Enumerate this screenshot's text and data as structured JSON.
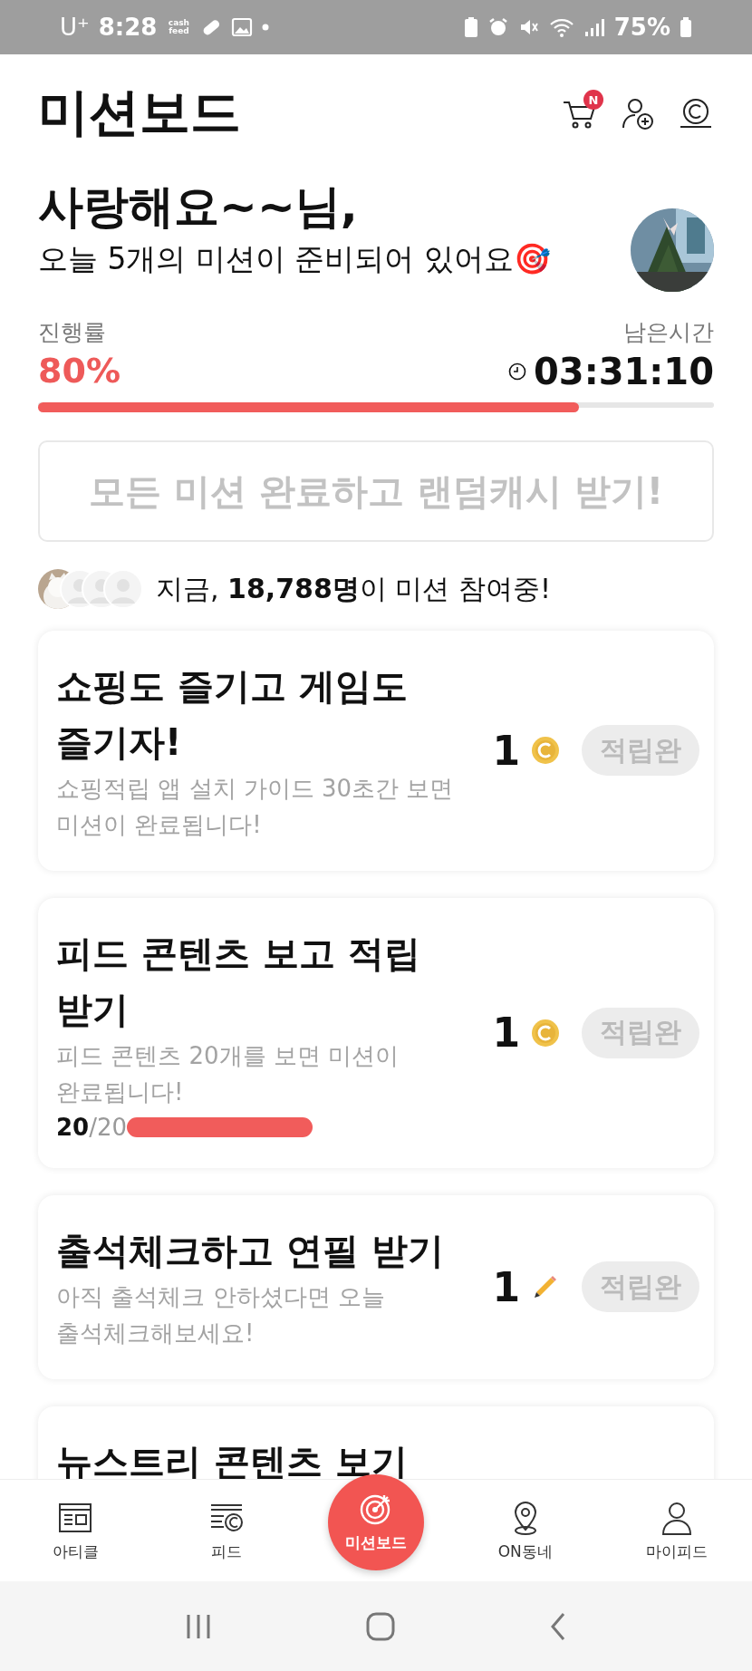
{
  "status_bar": {
    "carrier": "U⁺",
    "time": "8:28",
    "app_badge": "cash feed",
    "battery": "75%"
  },
  "header": {
    "title": "미션보드",
    "cart_badge": "N"
  },
  "greeting": {
    "name": "사랑해요~~님,",
    "subtitle": "오늘 5개의 미션이 준비되어 있어요🎯"
  },
  "progress": {
    "label": "진행률",
    "value": "80%",
    "level": 0.8,
    "time_label": "남은시간",
    "time": "03:31:10"
  },
  "reward_button": {
    "label": "모든 미션 완료하고 랜덤캐시 받기!",
    "disabled": true
  },
  "participants": {
    "text": "지금, **18,788명**이 미션 참여중!"
  },
  "missions": [
    {
      "title": "쇼핑도 즐기고 게임도 즐기자!",
      "description": "쇼핑적립 앱 설치 가이드 30초간 보면 미션이 완료됩니다!",
      "reward": "1",
      "kind": "coin",
      "button": "적립완",
      "claimed": true
    },
    {
      "title": "피드 콘텐츠 보고 적립 받기",
      "description": "피드 콘텐츠 20개를 보면 미션이 완료됩니다!",
      "reward": "1",
      "kind": "coin",
      "button": "적립완",
      "claimed": true,
      "count_done": "20",
      "count_total": "/20"
    },
    {
      "title": "출석체크하고 연필 받기",
      "description": "아직 출석체크 안하셨다면 오늘 출석체크해보세요!",
      "reward": "1",
      "kind": "pencil",
      "button": "적립완",
      "claimed": true
    },
    {
      "title": "뉴스트리 콘텐츠 보기"
    }
  ],
  "bottom_nav": [
    {
      "label": "아티클",
      "selected": false
    },
    {
      "label": "피드",
      "selected": false
    },
    {
      "label": "미션보드",
      "selected": true
    },
    {
      "label": "ON동네",
      "selected": false
    },
    {
      "label": "마이피드",
      "selected": false
    }
  ]
}
